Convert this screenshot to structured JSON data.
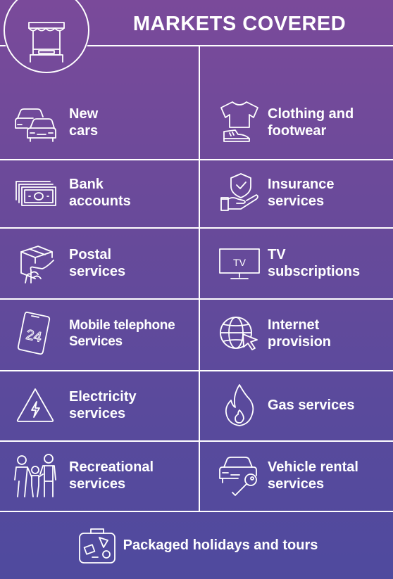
{
  "title": "MARKETS COVERED",
  "markets": [
    {
      "label": "New\ncars",
      "icon": "cars-icon"
    },
    {
      "label": "Clothing and\nfootwear",
      "icon": "tshirt-shoe-icon"
    },
    {
      "label": "Bank\naccounts",
      "icon": "banknotes-icon"
    },
    {
      "label": "Insurance\nservices",
      "icon": "shield-hand-icon"
    },
    {
      "label": "Postal\nservices",
      "icon": "parcel-hand-icon"
    },
    {
      "label": "TV\nsubscriptions",
      "icon": "tv-icon"
    },
    {
      "label": "Mobile telephone\nServices",
      "icon": "mobile-24-icon"
    },
    {
      "label": "Internet\nprovision",
      "icon": "globe-cursor-icon"
    },
    {
      "label": "Electricity\nservices",
      "icon": "electricity-warning-icon"
    },
    {
      "label": "Gas services",
      "icon": "flame-icon"
    },
    {
      "label": "Recreational\nservices",
      "icon": "family-icon"
    },
    {
      "label": "Vehicle rental\nservices",
      "icon": "car-key-icon"
    }
  ],
  "footer": {
    "label": "Packaged holidays and tours",
    "icon": "suitcase-icon"
  }
}
